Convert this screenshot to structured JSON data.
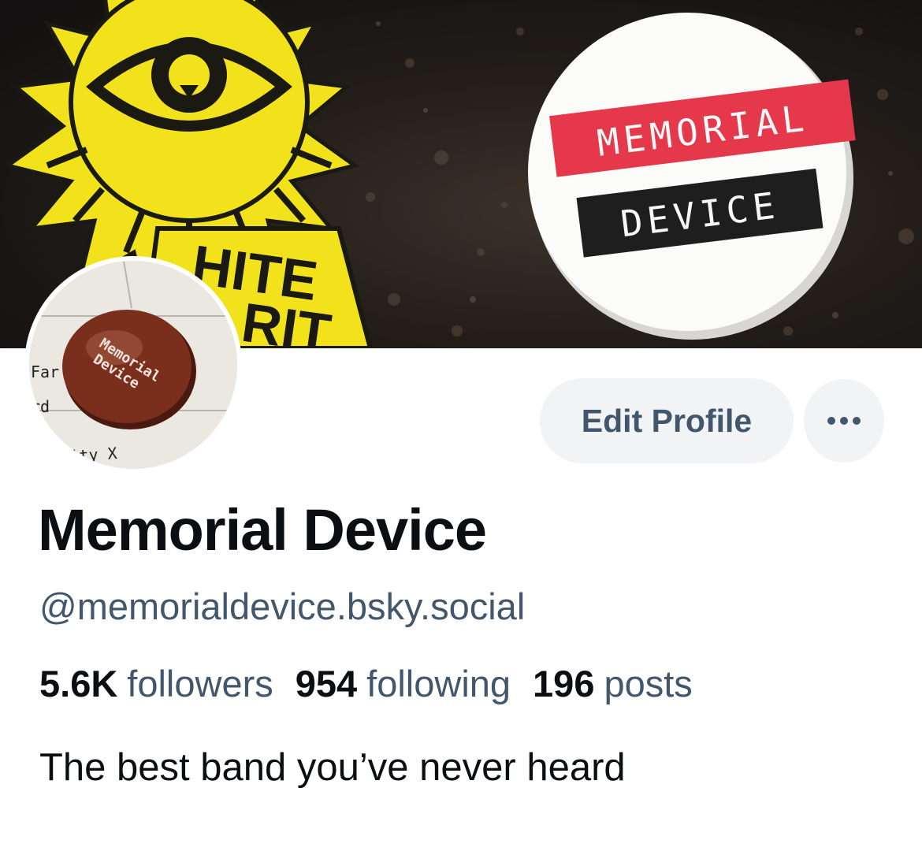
{
  "banner": {
    "left_pin_text": [
      "HITE",
      "RIT"
    ],
    "button_line1": "MEMORIAL",
    "button_line2": "DEVICE"
  },
  "avatar": {
    "badge_line1": "Memorial",
    "badge_line2": "Device",
    "paper_text": [
      "Far",
      "rd",
      "nity X"
    ]
  },
  "actions": {
    "edit_profile_label": "Edit Profile",
    "more_icon": "ellipsis-icon"
  },
  "profile": {
    "display_name": "Memorial Device",
    "handle": "@memorialdevice.bsky.social",
    "bio": "The best band you’ve never heard"
  },
  "stats": {
    "followers_count": "5.6K",
    "followers_label": "followers",
    "following_count": "954",
    "following_label": "following",
    "posts_count": "196",
    "posts_label": "posts"
  },
  "colors": {
    "primary_text": "#0b0f14",
    "secondary_text": "#42576c",
    "button_bg": "#f1f3f5",
    "pin_yellow": "#f2e21c",
    "label_red": "#e5394b",
    "badge_brown": "#7a2f1c"
  }
}
